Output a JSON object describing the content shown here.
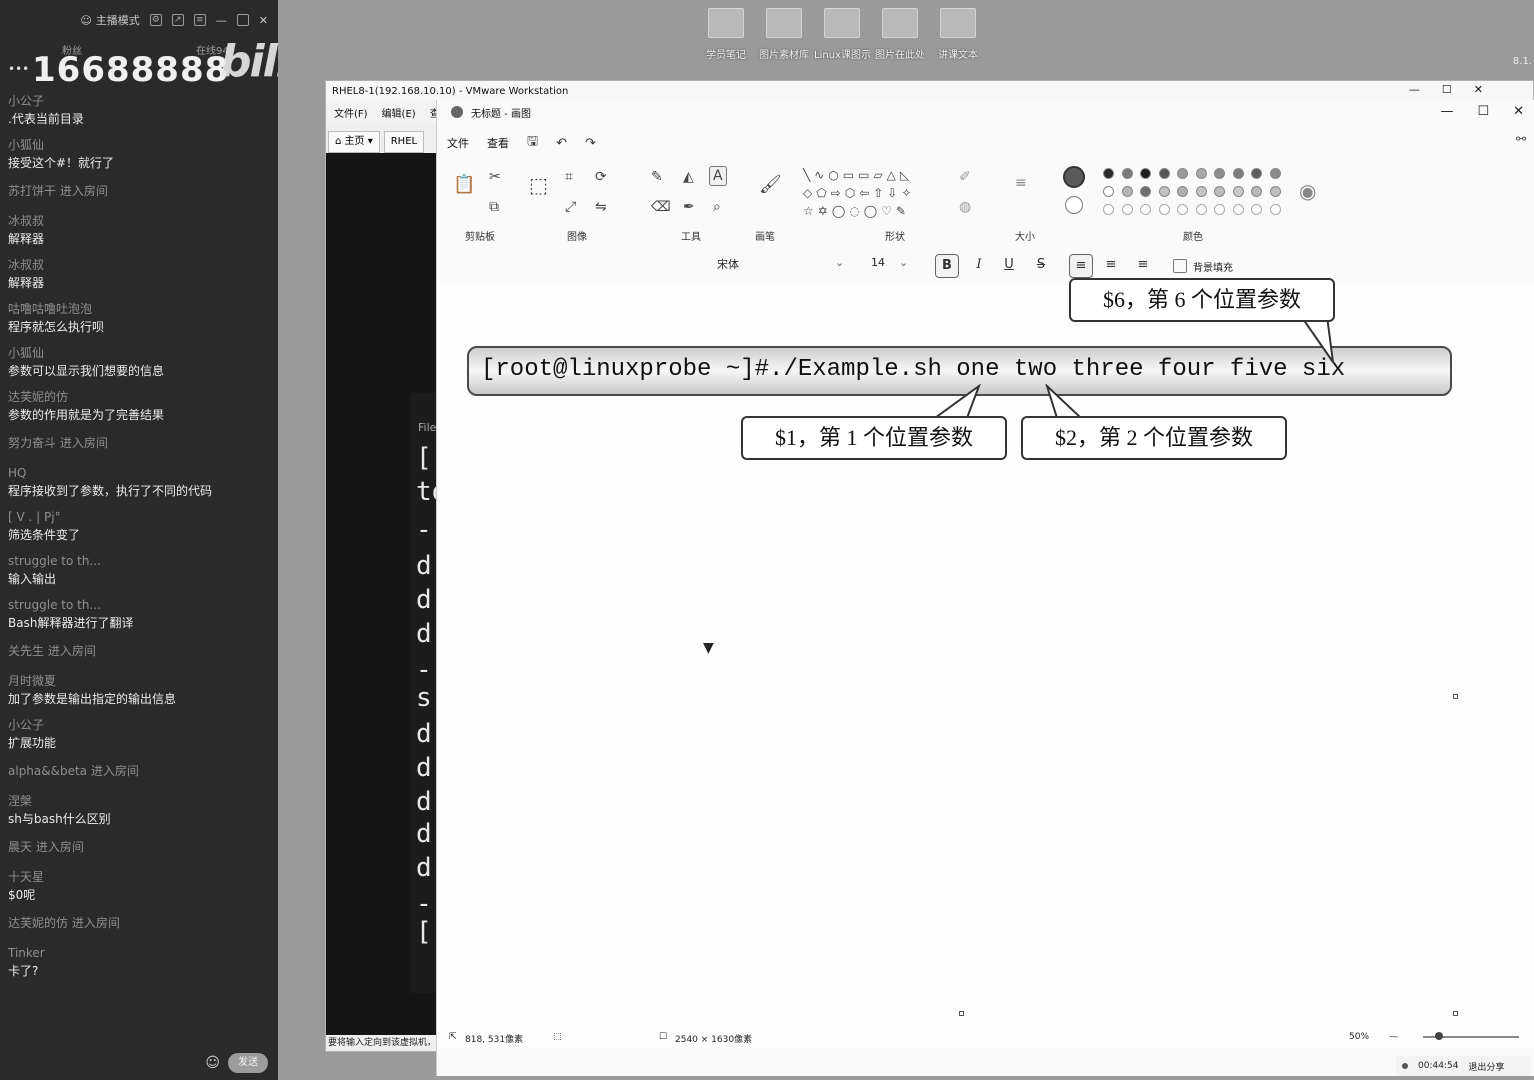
{
  "desktop": {
    "icons": [
      "学员笔记",
      "图片素材库",
      "Linux课图示",
      "图片在此处",
      "讲课文本"
    ],
    "right_label": "8.1."
  },
  "chat": {
    "mode_label": "主播模式",
    "lbl_left": "粉丝",
    "lbl_right": "在线94",
    "dots": "•••",
    "room_number": "16688888",
    "logo": "bilibili",
    "messages": [
      {
        "user": "小公子",
        "text": ".代表当前目录"
      },
      {
        "user": "小狐仙",
        "text": "接受这个#！就行了"
      },
      {
        "user": "苏打饼干 进入房间",
        "text": ""
      },
      {
        "user": "冰叔叔",
        "text": "解释器"
      },
      {
        "user": "冰叔叔",
        "text": "解释器"
      },
      {
        "user": "咕噜咕噜吐泡泡",
        "text": "程序就怎么执行呗"
      },
      {
        "user": "小狐仙",
        "text": "参数可以显示我们想要的信息"
      },
      {
        "user": "达芙妮的仿",
        "text": "参数的作用就是为了完善结果"
      },
      {
        "user": "努力奋斗 进入房间",
        "text": ""
      },
      {
        "user": "HQ",
        "text": "程序接收到了参数，执行了不同的代码"
      },
      {
        "user": "[ V . | Pj°",
        "text": "筛选条件变了"
      },
      {
        "user": "struggle to th...",
        "text": "输入输出"
      },
      {
        "user": "struggle to th...",
        "text": "Bash解释器进行了翻译"
      },
      {
        "user": "关先生 进入房间",
        "text": ""
      },
      {
        "user": "月时微夏",
        "text": "加了参数是输出指定的输出信息"
      },
      {
        "user": "小公子",
        "text": "扩展功能"
      },
      {
        "user": "alpha&&beta 进入房间",
        "text": ""
      },
      {
        "user": "涅槃",
        "text": "sh与bash什么区别"
      },
      {
        "user": "晨天 进入房间",
        "text": ""
      },
      {
        "user": "十天星",
        "text": "$0呢"
      },
      {
        "user": "达芙妮的仿 进入房间",
        "text": ""
      },
      {
        "user": "Tinker",
        "text": "卡了?"
      }
    ],
    "send_label": "发送"
  },
  "vmware": {
    "title": "RHEL8-1(192.168.10.10) - VMware Workstation",
    "menus": [
      "文件(F)",
      "编辑(E)",
      "查看"
    ],
    "tabs": [
      "主页",
      "RHEL"
    ],
    "pane_title": "File",
    "console_lines": [
      "[",
      "to",
      "-",
      "d",
      "d",
      "d",
      "-",
      "s",
      "d",
      "d",
      "d",
      "d",
      "d",
      "-",
      "["
    ],
    "status": "要将输入定向到该虚拟机，"
  },
  "paint": {
    "title": "无标题 - 画图",
    "menus": [
      "文件",
      "查看"
    ],
    "groups": {
      "clipboard": "剪贴板",
      "image": "图像",
      "tools": "工具",
      "brushes": "画笔",
      "shapes": "形状",
      "size": "大小",
      "colors": "颜色"
    },
    "font_name": "宋体",
    "font_size": "14",
    "bold": "B",
    "italic": "I",
    "underline": "U",
    "strike": "S",
    "fill_bg_label": "背景填充",
    "command_text": "[root@linuxprobe ~]#./Example.sh one two three four five six",
    "callouts": {
      "c6": "$6，第 6 个位置参数",
      "c1": "$1，第 1 个位置参数",
      "c2": "$2，第 2 个位置参数"
    },
    "status": {
      "cursor_pos": "818, 531像素",
      "canvas_size": "2540 × 1630像素",
      "zoom": "50%"
    },
    "colors": {
      "primary": "#5a5a5a",
      "secondary": "#ffffff",
      "row1": [
        "#2a2a2a",
        "#7a7a7a",
        "#1e1e1e",
        "#555555",
        "#9a9a9a",
        "#a8a8a8",
        "#8c8c8c",
        "#7c7c7c",
        "#5e5e5e",
        "#8a8a8a"
      ],
      "row2": [
        "#ffffff",
        "#b5b5b5",
        "#6e6e6e",
        "#c2c2c2",
        "#b0b0b0",
        "#c4c4c4",
        "#bcbcbc",
        "#c9c9c9",
        "#b8b8b8",
        "#bfbfbf"
      ]
    }
  },
  "recording": {
    "time": "00:44:54",
    "exit_label": "退出分享"
  }
}
